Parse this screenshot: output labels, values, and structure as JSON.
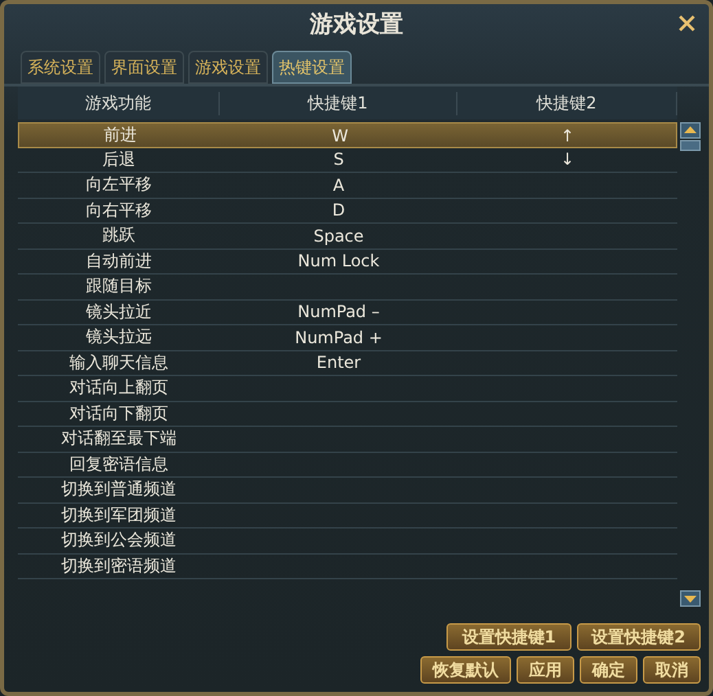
{
  "window": {
    "title": "游戏设置"
  },
  "tabs": [
    {
      "label": "系统设置",
      "selected": false
    },
    {
      "label": "界面设置",
      "selected": false
    },
    {
      "label": "游戏设置",
      "selected": false
    },
    {
      "label": "热键设置",
      "selected": true
    }
  ],
  "table": {
    "columns": [
      "游戏功能",
      "快捷键1",
      "快捷键2"
    ],
    "rows": [
      {
        "cells": [
          "前进",
          "W",
          "↑"
        ],
        "selected": true
      },
      {
        "cells": [
          "后退",
          "S",
          "↓"
        ],
        "selected": false
      },
      {
        "cells": [
          "向左平移",
          "A",
          ""
        ],
        "selected": false
      },
      {
        "cells": [
          "向右平移",
          "D",
          ""
        ],
        "selected": false
      },
      {
        "cells": [
          "跳跃",
          "Space",
          ""
        ],
        "selected": false
      },
      {
        "cells": [
          "自动前进",
          "Num Lock",
          ""
        ],
        "selected": false
      },
      {
        "cells": [
          "跟随目标",
          "",
          ""
        ],
        "selected": false
      },
      {
        "cells": [
          "镜头拉近",
          "NumPad –",
          ""
        ],
        "selected": false
      },
      {
        "cells": [
          "镜头拉远",
          "NumPad +",
          ""
        ],
        "selected": false
      },
      {
        "cells": [
          "输入聊天信息",
          "Enter",
          ""
        ],
        "selected": false
      },
      {
        "cells": [
          "对话向上翻页",
          "",
          ""
        ],
        "selected": false
      },
      {
        "cells": [
          "对话向下翻页",
          "",
          ""
        ],
        "selected": false
      },
      {
        "cells": [
          "对话翻至最下端",
          "",
          ""
        ],
        "selected": false
      },
      {
        "cells": [
          "回复密语信息",
          "",
          ""
        ],
        "selected": false
      },
      {
        "cells": [
          "切换到普通频道",
          "",
          ""
        ],
        "selected": false
      },
      {
        "cells": [
          "切换到军团频道",
          "",
          ""
        ],
        "selected": false
      },
      {
        "cells": [
          "切换到公会频道",
          "",
          ""
        ],
        "selected": false
      },
      {
        "cells": [
          "切换到密语频道",
          "",
          ""
        ],
        "selected": false
      }
    ]
  },
  "key_buttons": [
    "设置快捷键1",
    "设置快捷键2"
  ],
  "buttons": [
    "恢复默认",
    "应用",
    "确定",
    "取消"
  ]
}
